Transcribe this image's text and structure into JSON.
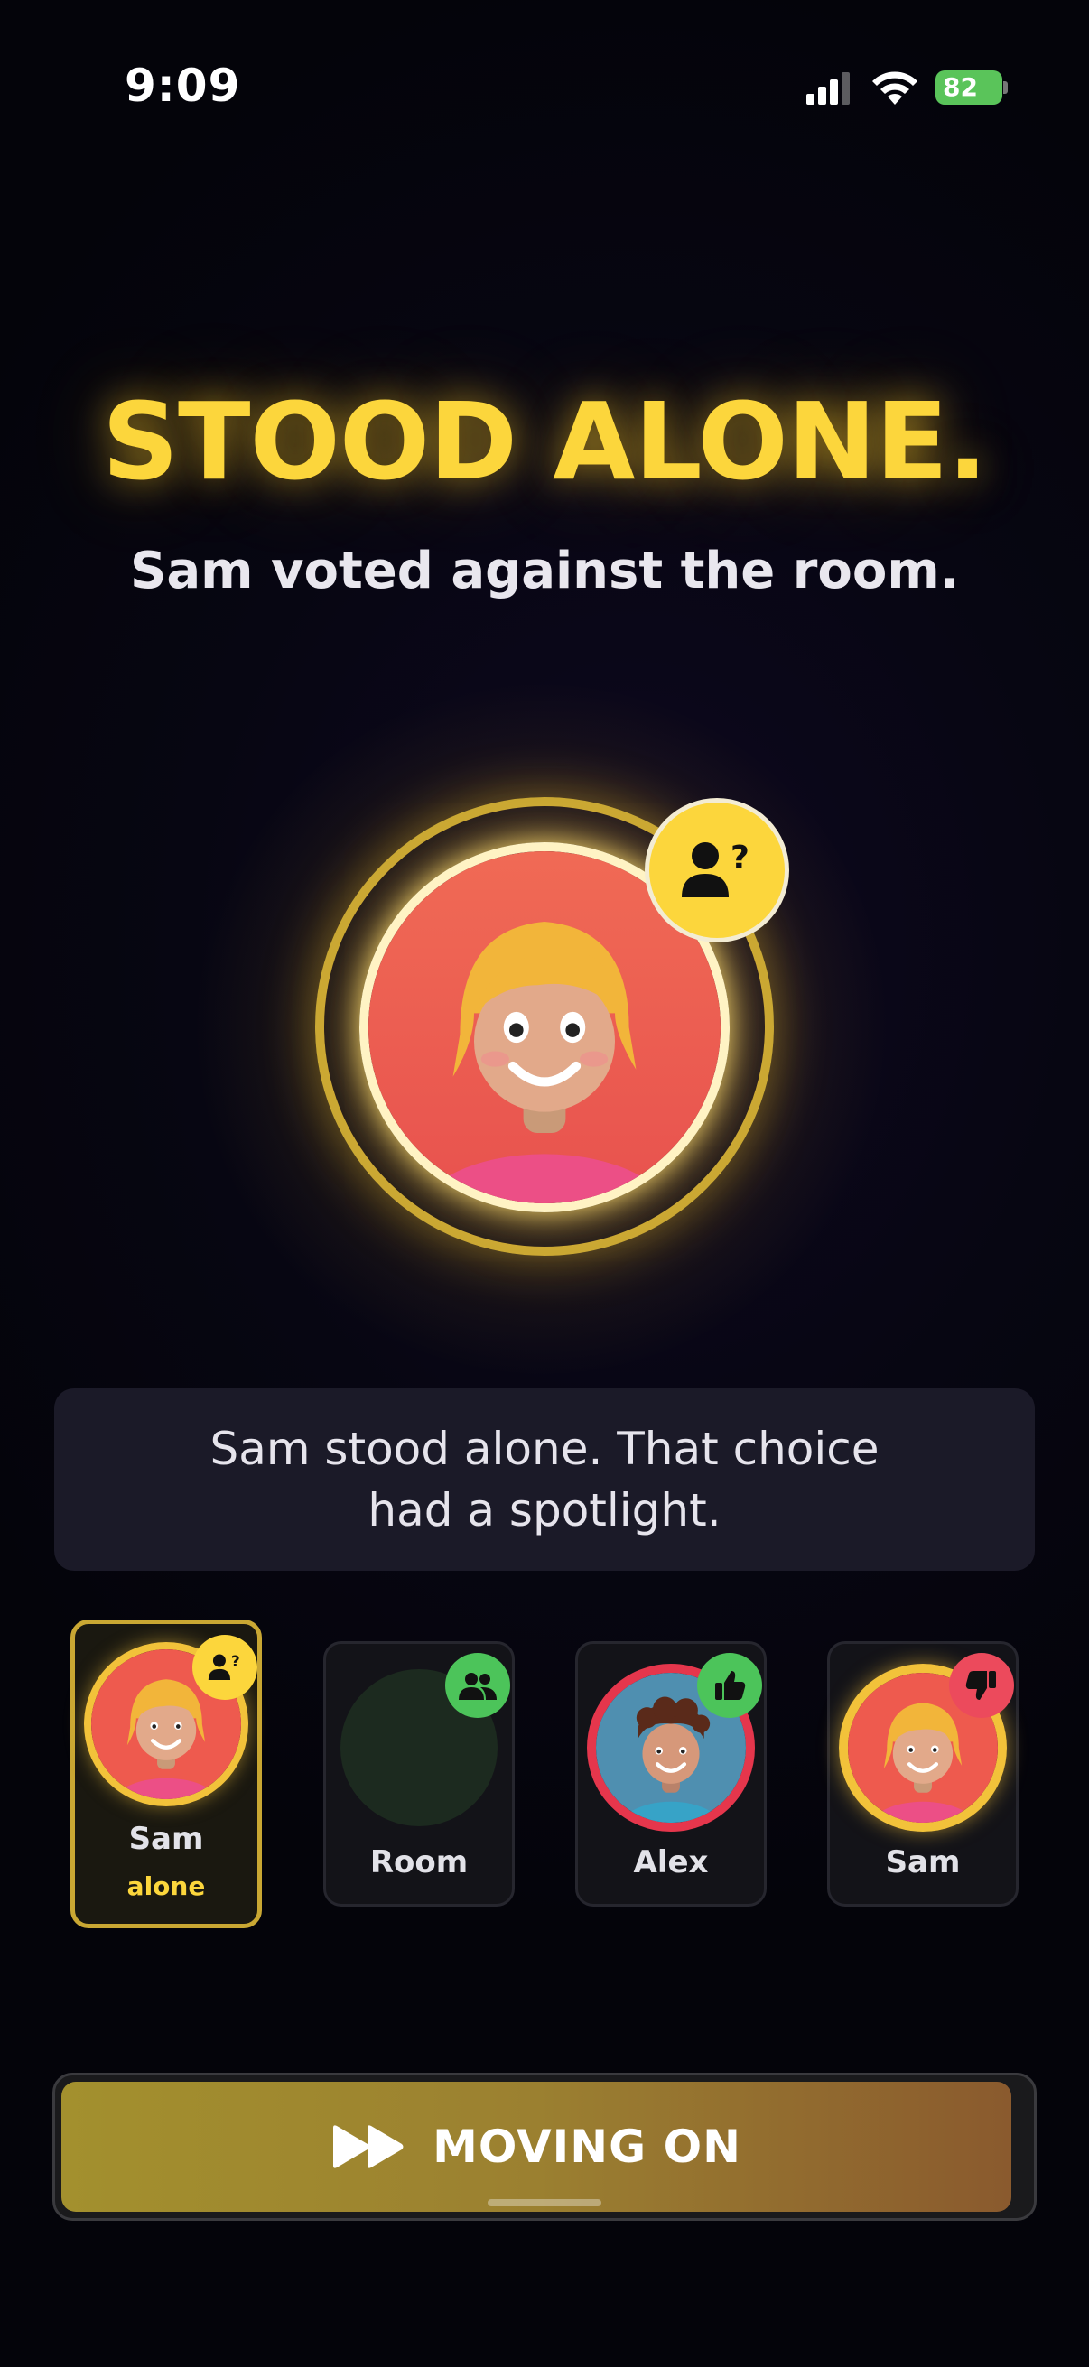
{
  "status_bar": {
    "time": "9:09",
    "battery": "82",
    "signal_icon": "cellular-signal-icon",
    "wifi_icon": "wifi-icon",
    "battery_icon": "battery-charging-icon"
  },
  "headline": "STOOD ALONE.",
  "subline": "Sam voted against the room.",
  "hero": {
    "avatar": "sam-avatar",
    "badge_icon": "person-question-icon",
    "colors": {
      "ring": "#c9a733",
      "badge": "#fcd63c",
      "avatar_bg": "#ee5a4e"
    }
  },
  "message": "Sam stood alone. That choice had a spotlight.",
  "cards": [
    {
      "name": "Sam",
      "tag": "alone",
      "badge_icon": "person-question-icon",
      "badge_color": "#fcd63c",
      "selected": true
    },
    {
      "name": "Room",
      "tag": "",
      "badge_icon": "group-icon",
      "badge_color": "#4cc45a",
      "selected": false
    },
    {
      "name": "Alex",
      "tag": "",
      "badge_icon": "thumbs-up-icon",
      "badge_color": "#4cc45a",
      "selected": false
    },
    {
      "name": "Sam",
      "tag": "",
      "badge_icon": "thumbs-down-icon",
      "badge_color": "#ec4a5c",
      "selected": false
    }
  ],
  "button": {
    "label": "MOVING ON",
    "icon": "fast-forward-icon"
  }
}
